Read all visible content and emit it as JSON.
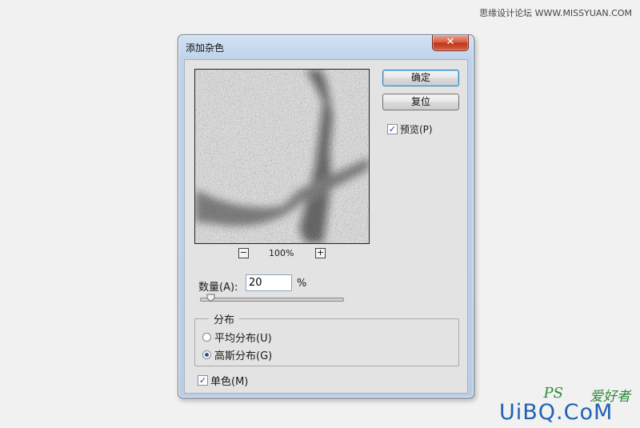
{
  "watermarks": {
    "top": "思缘设计论坛 WWW.MISSYUAN.COM",
    "bottom_ps": "PS",
    "bottom_cn": "爱好者",
    "bottom_uibq": "UiBQ.CoM",
    "bottom_site": ""
  },
  "dialog": {
    "title": "添加杂色",
    "close_label": "✕"
  },
  "preview": {
    "zoom_minus": "−",
    "zoom_value": "100%",
    "zoom_plus": "+"
  },
  "buttons": {
    "ok": "确定",
    "reset": "复位"
  },
  "preview_option": {
    "label": "预览(P)",
    "checked": true
  },
  "amount": {
    "label": "数量(A):",
    "value": "20",
    "unit": "%",
    "slider_fraction": 0.05
  },
  "distribution": {
    "title": "分布",
    "options": [
      {
        "label": "平均分布(U)",
        "selected": false
      },
      {
        "label": "高斯分布(G)",
        "selected": true
      }
    ]
  },
  "monochromatic": {
    "label": "单色(M)",
    "checked": true
  },
  "colors": {
    "ok_border": "#3c7fb1",
    "close_red": "#c0321a",
    "radio_dot": "#2a4f96"
  }
}
